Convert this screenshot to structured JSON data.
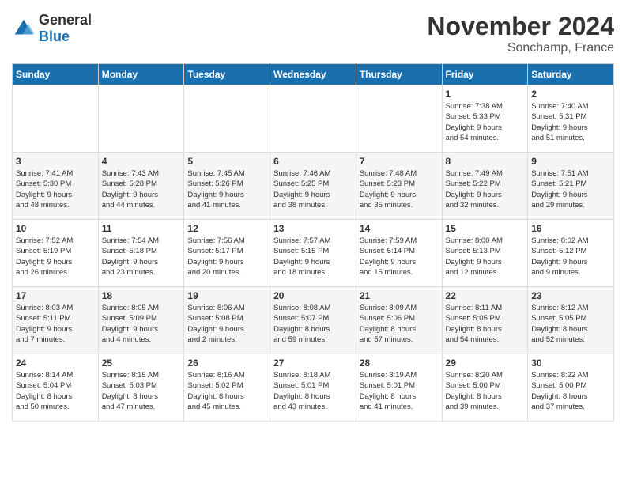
{
  "header": {
    "logo_general": "General",
    "logo_blue": "Blue",
    "month_title": "November 2024",
    "location": "Sonchamp, France"
  },
  "days_of_week": [
    "Sunday",
    "Monday",
    "Tuesday",
    "Wednesday",
    "Thursday",
    "Friday",
    "Saturday"
  ],
  "weeks": [
    [
      {
        "day": "",
        "info": ""
      },
      {
        "day": "",
        "info": ""
      },
      {
        "day": "",
        "info": ""
      },
      {
        "day": "",
        "info": ""
      },
      {
        "day": "",
        "info": ""
      },
      {
        "day": "1",
        "info": "Sunrise: 7:38 AM\nSunset: 5:33 PM\nDaylight: 9 hours\nand 54 minutes."
      },
      {
        "day": "2",
        "info": "Sunrise: 7:40 AM\nSunset: 5:31 PM\nDaylight: 9 hours\nand 51 minutes."
      }
    ],
    [
      {
        "day": "3",
        "info": "Sunrise: 7:41 AM\nSunset: 5:30 PM\nDaylight: 9 hours\nand 48 minutes."
      },
      {
        "day": "4",
        "info": "Sunrise: 7:43 AM\nSunset: 5:28 PM\nDaylight: 9 hours\nand 44 minutes."
      },
      {
        "day": "5",
        "info": "Sunrise: 7:45 AM\nSunset: 5:26 PM\nDaylight: 9 hours\nand 41 minutes."
      },
      {
        "day": "6",
        "info": "Sunrise: 7:46 AM\nSunset: 5:25 PM\nDaylight: 9 hours\nand 38 minutes."
      },
      {
        "day": "7",
        "info": "Sunrise: 7:48 AM\nSunset: 5:23 PM\nDaylight: 9 hours\nand 35 minutes."
      },
      {
        "day": "8",
        "info": "Sunrise: 7:49 AM\nSunset: 5:22 PM\nDaylight: 9 hours\nand 32 minutes."
      },
      {
        "day": "9",
        "info": "Sunrise: 7:51 AM\nSunset: 5:21 PM\nDaylight: 9 hours\nand 29 minutes."
      }
    ],
    [
      {
        "day": "10",
        "info": "Sunrise: 7:52 AM\nSunset: 5:19 PM\nDaylight: 9 hours\nand 26 minutes."
      },
      {
        "day": "11",
        "info": "Sunrise: 7:54 AM\nSunset: 5:18 PM\nDaylight: 9 hours\nand 23 minutes."
      },
      {
        "day": "12",
        "info": "Sunrise: 7:56 AM\nSunset: 5:17 PM\nDaylight: 9 hours\nand 20 minutes."
      },
      {
        "day": "13",
        "info": "Sunrise: 7:57 AM\nSunset: 5:15 PM\nDaylight: 9 hours\nand 18 minutes."
      },
      {
        "day": "14",
        "info": "Sunrise: 7:59 AM\nSunset: 5:14 PM\nDaylight: 9 hours\nand 15 minutes."
      },
      {
        "day": "15",
        "info": "Sunrise: 8:00 AM\nSunset: 5:13 PM\nDaylight: 9 hours\nand 12 minutes."
      },
      {
        "day": "16",
        "info": "Sunrise: 8:02 AM\nSunset: 5:12 PM\nDaylight: 9 hours\nand 9 minutes."
      }
    ],
    [
      {
        "day": "17",
        "info": "Sunrise: 8:03 AM\nSunset: 5:11 PM\nDaylight: 9 hours\nand 7 minutes."
      },
      {
        "day": "18",
        "info": "Sunrise: 8:05 AM\nSunset: 5:09 PM\nDaylight: 9 hours\nand 4 minutes."
      },
      {
        "day": "19",
        "info": "Sunrise: 8:06 AM\nSunset: 5:08 PM\nDaylight: 9 hours\nand 2 minutes."
      },
      {
        "day": "20",
        "info": "Sunrise: 8:08 AM\nSunset: 5:07 PM\nDaylight: 8 hours\nand 59 minutes."
      },
      {
        "day": "21",
        "info": "Sunrise: 8:09 AM\nSunset: 5:06 PM\nDaylight: 8 hours\nand 57 minutes."
      },
      {
        "day": "22",
        "info": "Sunrise: 8:11 AM\nSunset: 5:05 PM\nDaylight: 8 hours\nand 54 minutes."
      },
      {
        "day": "23",
        "info": "Sunrise: 8:12 AM\nSunset: 5:05 PM\nDaylight: 8 hours\nand 52 minutes."
      }
    ],
    [
      {
        "day": "24",
        "info": "Sunrise: 8:14 AM\nSunset: 5:04 PM\nDaylight: 8 hours\nand 50 minutes."
      },
      {
        "day": "25",
        "info": "Sunrise: 8:15 AM\nSunset: 5:03 PM\nDaylight: 8 hours\nand 47 minutes."
      },
      {
        "day": "26",
        "info": "Sunrise: 8:16 AM\nSunset: 5:02 PM\nDaylight: 8 hours\nand 45 minutes."
      },
      {
        "day": "27",
        "info": "Sunrise: 8:18 AM\nSunset: 5:01 PM\nDaylight: 8 hours\nand 43 minutes."
      },
      {
        "day": "28",
        "info": "Sunrise: 8:19 AM\nSunset: 5:01 PM\nDaylight: 8 hours\nand 41 minutes."
      },
      {
        "day": "29",
        "info": "Sunrise: 8:20 AM\nSunset: 5:00 PM\nDaylight: 8 hours\nand 39 minutes."
      },
      {
        "day": "30",
        "info": "Sunrise: 8:22 AM\nSunset: 5:00 PM\nDaylight: 8 hours\nand 37 minutes."
      }
    ]
  ]
}
